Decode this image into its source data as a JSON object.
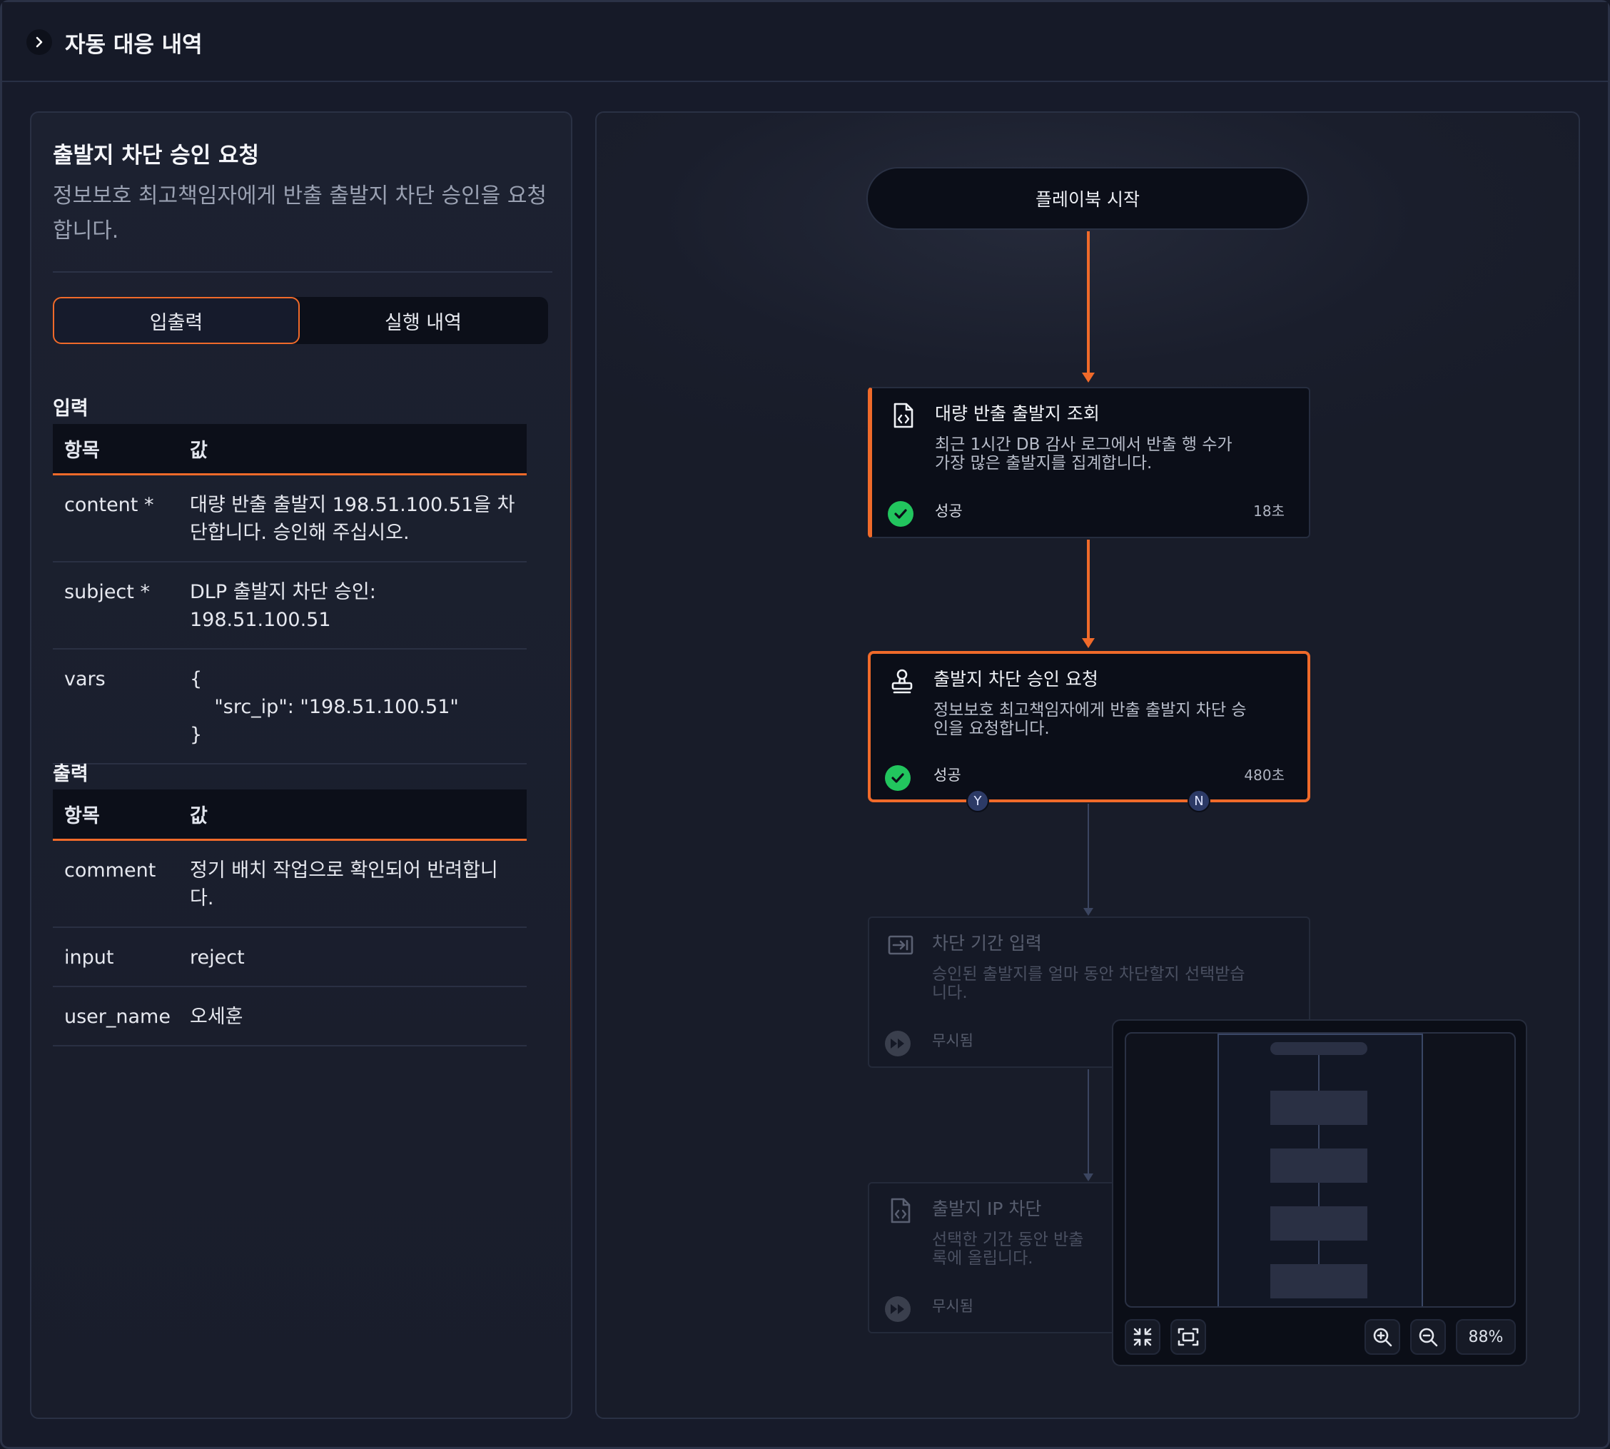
{
  "header": {
    "title": "자동 대응 내역",
    "toggle_icon": "chevron-right-icon"
  },
  "detail": {
    "title": "출발지 차단 승인 요청",
    "description": "정보보호 최고책임자에게 반출 출발지 차단 승인을 요청합니다.",
    "tabs": [
      {
        "label": "입출력",
        "active": true
      },
      {
        "label": "실행 내역",
        "active": false
      }
    ],
    "input": {
      "label": "입력",
      "columns": [
        "항목",
        "값"
      ],
      "rows": [
        {
          "key": "content *",
          "value": "대량 반출 출발지 198.51.100.51을 차단합니다. 승인해 주십시오."
        },
        {
          "key": "subject *",
          "value": "DLP 출발지 차단 승인: 198.51.100.51"
        },
        {
          "key": "vars",
          "value": "{\n    \"src_ip\": \"198.51.100.51\"\n}"
        }
      ]
    },
    "output": {
      "label": "출력",
      "columns": [
        "항목",
        "값"
      ],
      "rows": [
        {
          "key": "comment",
          "value": "정기 배치 작업으로 확인되어 반려합니다."
        },
        {
          "key": "input",
          "value": "reject"
        },
        {
          "key": "user_name",
          "value": "오세훈"
        }
      ]
    }
  },
  "flow": {
    "start_label": "플레이북 시작",
    "nodes": [
      {
        "title": "대량 반출 출발지 조회",
        "description": "최근 1시간 DB 감사 로그에서 반출 행 수가 가장 많은 출발지를 집계합니다.",
        "status": "성공",
        "duration": "18초",
        "icon": "code-file-icon",
        "state": "success"
      },
      {
        "title": "출발지 차단 승인 요청",
        "description": "정보보호 최고책임자에게 반출 출발지 차단 승인을 요청합니다.",
        "status": "성공",
        "duration": "480초",
        "icon": "approval-stamp-icon",
        "state": "success-selected",
        "branches": [
          "Y",
          "N"
        ]
      },
      {
        "title": "차단 기간 입력",
        "description": "승인된 출발지를 얼마 동안 차단할지 선택받습니다.",
        "status": "무시됨",
        "icon": "input-icon",
        "state": "skipped"
      },
      {
        "title": "출발지 IP 차단",
        "description": "선택한 기간 동안 반출 록에 올립니다.",
        "status": "무시됨",
        "icon": "code-file-icon",
        "state": "skipped"
      }
    ],
    "colors": {
      "accent": "#f06a2a",
      "success": "#22c55e",
      "node_bg": "#0b0e18",
      "branch": "#2c3a66"
    }
  },
  "minimap": {
    "zoom": "88%",
    "controls": [
      "collapse-icon",
      "fit-view-icon",
      "zoom-in-icon",
      "zoom-out-icon"
    ]
  }
}
